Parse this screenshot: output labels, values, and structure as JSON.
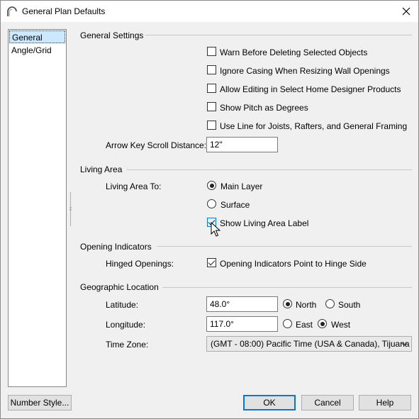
{
  "window": {
    "title": "General Plan Defaults",
    "close_icon": "close-icon",
    "app_icon": "arch-icon"
  },
  "sidebar": {
    "items": [
      {
        "label": "General",
        "selected": true
      },
      {
        "label": "Angle/Grid",
        "selected": false
      }
    ]
  },
  "general_settings": {
    "heading": "General Settings",
    "warn_before_deleting": {
      "label": "Warn Before Deleting Selected Objects",
      "checked": false
    },
    "ignore_casing": {
      "label": "Ignore Casing When Resizing Wall Openings",
      "checked": false
    },
    "allow_editing": {
      "label": "Allow Editing in Select Home Designer Products",
      "checked": false
    },
    "show_pitch": {
      "label": "Show Pitch as Degrees",
      "checked": false
    },
    "use_line": {
      "label": "Use Line for Joists, Rafters, and General Framing",
      "checked": false
    },
    "arrow_key_label": "Arrow Key Scroll Distance:",
    "arrow_key_value": "12\""
  },
  "living_area": {
    "heading": "Living Area",
    "to_label": "Living Area To:",
    "main_layer": {
      "label": "Main Layer",
      "checked": true
    },
    "surface": {
      "label": "Surface",
      "checked": false
    },
    "show_label": {
      "label": "Show Living Area Label",
      "checked": true
    }
  },
  "opening_indicators": {
    "heading": "Opening Indicators",
    "hinged_label": "Hinged Openings:",
    "point_to_hinge": {
      "label": "Opening Indicators Point to Hinge Side",
      "checked": true
    }
  },
  "geographic_location": {
    "heading": "Geographic Location",
    "latitude_label": "Latitude:",
    "latitude_value": "48.0°",
    "north": {
      "label": "North",
      "checked": true
    },
    "south": {
      "label": "South",
      "checked": false
    },
    "longitude_label": "Longitude:",
    "longitude_value": "117.0°",
    "east": {
      "label": "East",
      "checked": false
    },
    "west": {
      "label": "West",
      "checked": true
    },
    "timezone_label": "Time Zone:",
    "timezone_value": "(GMT - 08:00) Pacific Time (USA & Canada), Tijuana"
  },
  "buttons": {
    "number_style": "Number Style...",
    "ok": "OK",
    "cancel": "Cancel",
    "help": "Help"
  },
  "colors": {
    "accent": "#0078d7",
    "selection": "#cce8ff",
    "window_bg": "#f0f0f0"
  }
}
